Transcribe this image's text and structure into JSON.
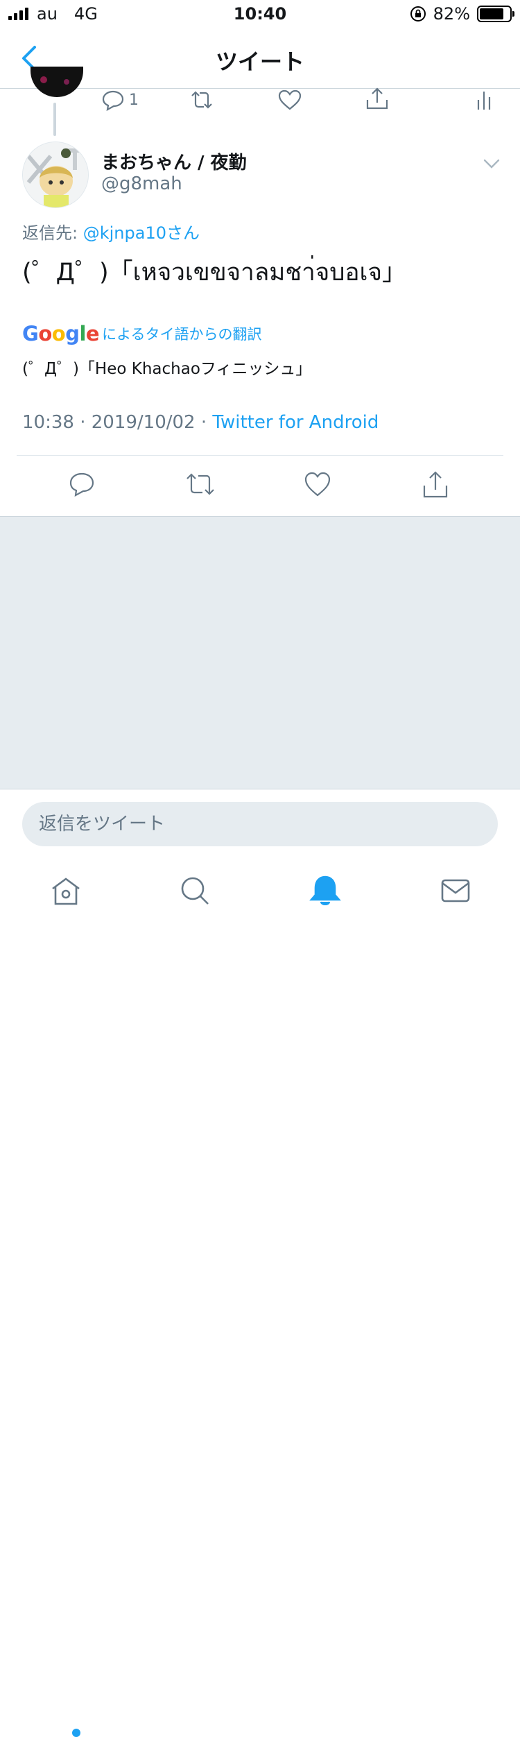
{
  "status_bar": {
    "carrier": "au",
    "network": "4G",
    "time": "10:40",
    "battery_percent": "82%",
    "battery_level": 0.82
  },
  "nav": {
    "title": "ツイート",
    "back_icon": "chevron-left-icon"
  },
  "previous_tweet": {
    "reply_count": "1"
  },
  "tweet": {
    "display_name": "まおちゃん / 夜勤",
    "handle": "@g8mah",
    "reply_prefix": "返信先: ",
    "reply_mention": "@kjnpa10さん",
    "text": "(゜Д゜)「เหจวเขขจาลมชา่จบอเจ」",
    "translate_brand": "Google",
    "translate_label": "によるタイ語からの翻訳",
    "translation": "(゜Д゜)「Heo Khachaoフィニッシュ」",
    "time": "10:38",
    "separator": " · ",
    "date": "2019/10/02",
    "source": "Twitter for Android"
  },
  "composer": {
    "placeholder": "返信をツイート"
  },
  "tab_bar": {
    "items": [
      "home-icon",
      "search-icon",
      "notifications-icon",
      "messages-icon"
    ],
    "active": "notifications-icon"
  },
  "colors": {
    "accent": "#1da1f2",
    "secondary_text": "#657786",
    "background_gray": "#e6ecf0"
  }
}
